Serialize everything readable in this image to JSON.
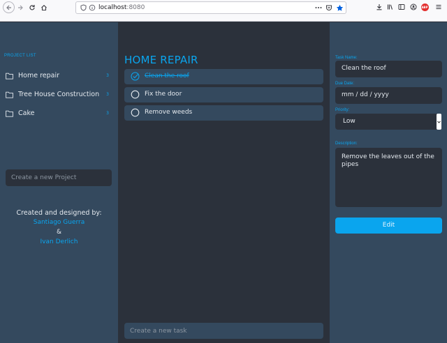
{
  "browser": {
    "url_host": "localhost",
    "url_port": ":8080",
    "abp_label": "ABP"
  },
  "sidebar": {
    "heading": "PROJECT LIST",
    "projects": [
      {
        "name": "Home repair",
        "count": "3"
      },
      {
        "name": "Tree House Construction",
        "count": "3"
      },
      {
        "name": "Cake",
        "count": "3"
      }
    ],
    "new_project_placeholder": "Create a new Project",
    "credits": {
      "title": "Created and designed by:",
      "author1": "Santiago Guerra",
      "separator": "&",
      "author2": "Ivan Derlich"
    }
  },
  "main": {
    "title": "HOME REPAIR",
    "tasks": [
      {
        "label": "Clean the roof",
        "done": true
      },
      {
        "label": "Fix the door",
        "done": false
      },
      {
        "label": "Remove weeds",
        "done": false
      }
    ],
    "new_task_placeholder": "Create a new task"
  },
  "details": {
    "task_name_label": "Task Name:",
    "task_name_value": "Clean the roof",
    "due_date_label": "Due Date:",
    "due_date_value": "mm / dd / yyyy",
    "priority_label": "Priority:",
    "priority_value": "Low",
    "description_label": "Description:",
    "description_value": "Remove the leaves out of the pipes",
    "edit_label": "Edit"
  },
  "colors": {
    "accent": "#0aa5ee",
    "panel": "#34495e",
    "background": "#2b313b"
  }
}
